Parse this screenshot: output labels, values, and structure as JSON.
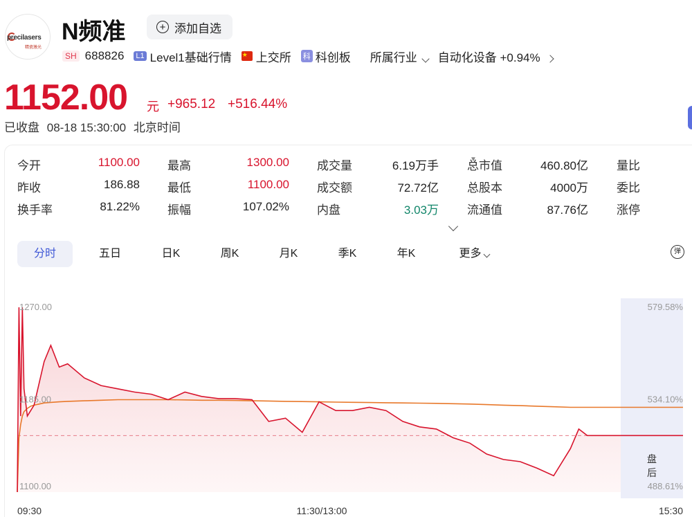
{
  "header": {
    "logo_text": "precilasers",
    "logo_sub": "精瓷激光",
    "title": "N频准",
    "add_watchlist_label": "添加自选"
  },
  "tags": {
    "market": "SH",
    "code": "688826",
    "level_badge": "L1",
    "level_label": "Level1基础行情",
    "exchange": "上交所",
    "board_badge": "科",
    "board": "科创板",
    "industry_label": "所属行业",
    "industry_name": "自动化设备",
    "industry_change": "+0.94%"
  },
  "quote": {
    "price": "1152.00",
    "unit": "元",
    "change": "+965.12",
    "change_pct": "+516.44%",
    "status": "已收盘",
    "time": "08-18 15:30:00",
    "timezone": "北京时间"
  },
  "stats": [
    [
      {
        "label": "今开",
        "value": "1100.00",
        "color": "red"
      },
      {
        "label": "最高",
        "value": "1300.00",
        "color": "red"
      },
      {
        "label": "成交量",
        "value": "6.19万手",
        "color": "black"
      },
      {
        "label": "总市值",
        "value": "460.80亿",
        "color": "black"
      },
      {
        "label": "量比",
        "value": "",
        "color": "black"
      }
    ],
    [
      {
        "label": "昨收",
        "value": "186.88",
        "color": "black"
      },
      {
        "label": "最低",
        "value": "1100.00",
        "color": "red"
      },
      {
        "label": "成交额",
        "value": "72.72亿",
        "color": "black"
      },
      {
        "label": "总股本",
        "value": "4000万",
        "color": "black"
      },
      {
        "label": "委比",
        "value": "",
        "color": "black"
      }
    ],
    [
      {
        "label": "换手率",
        "value": "81.22%",
        "color": "black"
      },
      {
        "label": "振幅",
        "value": "107.02%",
        "color": "black"
      },
      {
        "label": "内盘",
        "value": "3.03万",
        "color": "green"
      },
      {
        "label": "流通值",
        "value": "87.76亿",
        "color": "black"
      },
      {
        "label": "涨停",
        "value": "",
        "color": "black"
      }
    ]
  ],
  "tabs": [
    "分时",
    "五日",
    "日K",
    "周K",
    "月K",
    "季K",
    "年K",
    "更多"
  ],
  "active_tab": "分时",
  "colors": {
    "up": "#d8142d",
    "down": "#12866a",
    "accent": "#3f57d6",
    "avg_line": "#e8782a",
    "price_line": "#d8142d"
  },
  "chart_data": {
    "type": "line",
    "y_left_ticks": [
      "1270.00",
      "1185.00",
      "1100.00"
    ],
    "y_right_ticks": [
      "579.58%",
      "534.10%",
      "488.61%"
    ],
    "x_ticks": [
      "09:30",
      "11:30/13:00",
      "15:30"
    ],
    "ylim": [
      1100,
      1270
    ],
    "prev_close_ref": 1152.0,
    "after_hours_label": "盘后",
    "x_minutes": [
      0,
      1,
      2,
      3,
      4,
      6,
      8,
      10,
      13,
      16,
      20,
      25,
      30,
      40,
      50,
      60,
      70,
      80,
      90,
      100,
      110,
      120,
      130,
      140,
      150,
      160,
      170,
      180,
      190,
      200,
      210,
      220,
      230,
      240,
      250,
      260,
      270,
      280,
      290,
      300,
      310,
      320,
      330,
      335,
      340,
      345,
      350,
      355,
      360
    ],
    "price": [
      1100,
      1270,
      1170,
      1270,
      1195,
      1170,
      1175,
      1180,
      1200,
      1220,
      1235,
      1215,
      1218,
      1205,
      1198,
      1195,
      1192,
      1190,
      1185,
      1192,
      1188,
      1186,
      1186,
      1185,
      1165,
      1168,
      1155,
      1183,
      1175,
      1175,
      1178,
      1175,
      1165,
      1160,
      1158,
      1150,
      1145,
      1135,
      1130,
      1128,
      1122,
      1115,
      1140,
      1158,
      1152,
      1152,
      1152,
      1152,
      1152
    ],
    "avg": [
      1100,
      1150,
      1162,
      1170,
      1174,
      1177,
      1179,
      1180,
      1181,
      1182,
      1182.5,
      1183,
      1183.5,
      1184,
      1184.5,
      1185,
      1185,
      1185,
      1185,
      1184.8,
      1184.5,
      1184.5,
      1184.3,
      1184,
      1183.8,
      1183.5,
      1183.3,
      1183,
      1182.8,
      1182.6,
      1182.4,
      1182.2,
      1182,
      1181.8,
      1181.6,
      1181.3,
      1181,
      1180.5,
      1180,
      1179.5,
      1179,
      1178.5,
      1178,
      1178,
      1178,
      1178,
      1178,
      1178,
      1178
    ]
  }
}
